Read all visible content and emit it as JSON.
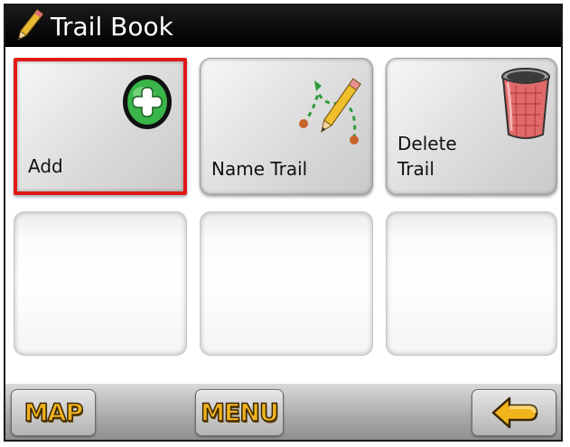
{
  "window": {
    "title": "Trail Book",
    "title_icon": "pencil-icon"
  },
  "tiles": [
    {
      "label": "Add",
      "icon": "add-plus-icon",
      "selected": true
    },
    {
      "label": "Name Trail",
      "icon": "edit-trail-icon",
      "selected": false
    },
    {
      "label": "Delete\nTrail",
      "icon": "trash-can-icon",
      "selected": false
    }
  ],
  "bottom_bar": {
    "map_label": "MAP",
    "menu_label": "MENU",
    "back_icon": "back-arrow-icon"
  },
  "colors": {
    "title_bar": "#000000",
    "selection": "#e01818",
    "button_text": "#f0b21e",
    "add_icon": "#3ab84a"
  }
}
